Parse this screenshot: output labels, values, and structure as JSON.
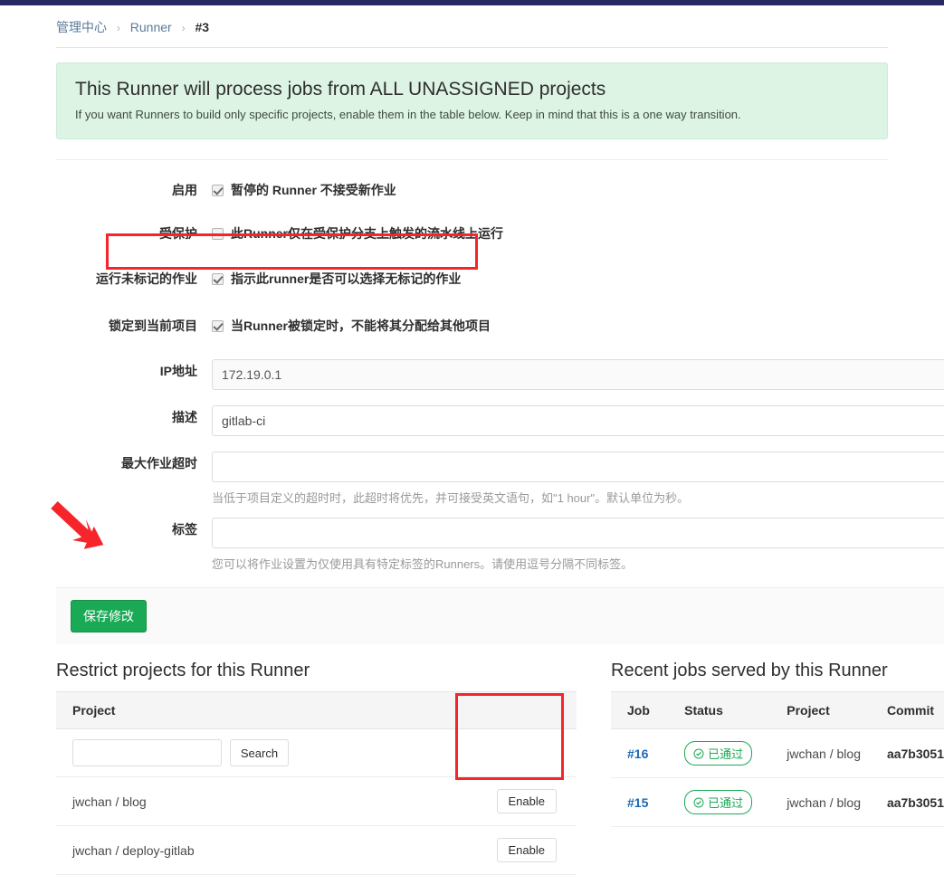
{
  "breadcrumb": {
    "admin": "管理中心",
    "runner": "Runner",
    "current": "#3",
    "separator": "›"
  },
  "alert": {
    "title": "This Runner will process jobs from ALL UNASSIGNED projects",
    "description": "If you want Runners to build only specific projects, enable them in the table below. Keep in mind that this is a one way transition."
  },
  "form": {
    "active": {
      "label": "启用",
      "checkbox_label": "暂停的 Runner 不接受新作业",
      "checked": true
    },
    "protected": {
      "label": "受保护",
      "checkbox_label": "此Runner仅在受保护分支上触发的流水线上运行",
      "checked": false
    },
    "run_untagged": {
      "label": "运行未标记的作业",
      "checkbox_label": "指示此runner是否可以选择无标记的作业",
      "checked": true
    },
    "locked": {
      "label": "锁定到当前项目",
      "checkbox_label": "当Runner被锁定时，不能将其分配给其他项目",
      "checked": true
    },
    "ip_address": {
      "label": "IP地址",
      "value": "172.19.0.1",
      "placeholder": ""
    },
    "description": {
      "label": "描述",
      "value": "gitlab-ci",
      "placeholder": ""
    },
    "max_timeout": {
      "label": "最大作业超时",
      "value": "",
      "placeholder": "",
      "help": "当低于项目定义的超时时，此超时将优先，并可接受英文语句，如\"1 hour\"。默认单位为秒。"
    },
    "tags": {
      "label": "标签",
      "value": "",
      "placeholder": "",
      "help": "您可以将作业设置为仅使用具有特定标签的Runners。请使用逗号分隔不同标签。"
    },
    "save_label": "保存修改"
  },
  "restrict_panel": {
    "title": "Restrict projects for this Runner",
    "column_header": "Project",
    "search_value": "",
    "search_placeholder": "",
    "search_button": "Search",
    "rows": [
      {
        "project": "jwchan / blog",
        "action": "Enable"
      },
      {
        "project": "jwchan / deploy-gitlab",
        "action": "Enable"
      }
    ]
  },
  "jobs_panel": {
    "title": "Recent jobs served by this Runner",
    "columns": [
      "Job",
      "Status",
      "Project",
      "Commit"
    ],
    "rows": [
      {
        "job": "#16",
        "status": "已通过",
        "project": "jwchan / blog",
        "commit": "aa7b3051"
      },
      {
        "job": "#15",
        "status": "已通过",
        "project": "jwchan / blog",
        "commit": "aa7b3051"
      }
    ]
  },
  "annotations": {
    "arrow_color": "#f5252b",
    "box_color": "#f5252b"
  },
  "colors": {
    "accent_green": "#1aaa55",
    "alert_bg": "#ddf4e4",
    "link_blue": "#1b69b6",
    "navbar": "#292961"
  }
}
